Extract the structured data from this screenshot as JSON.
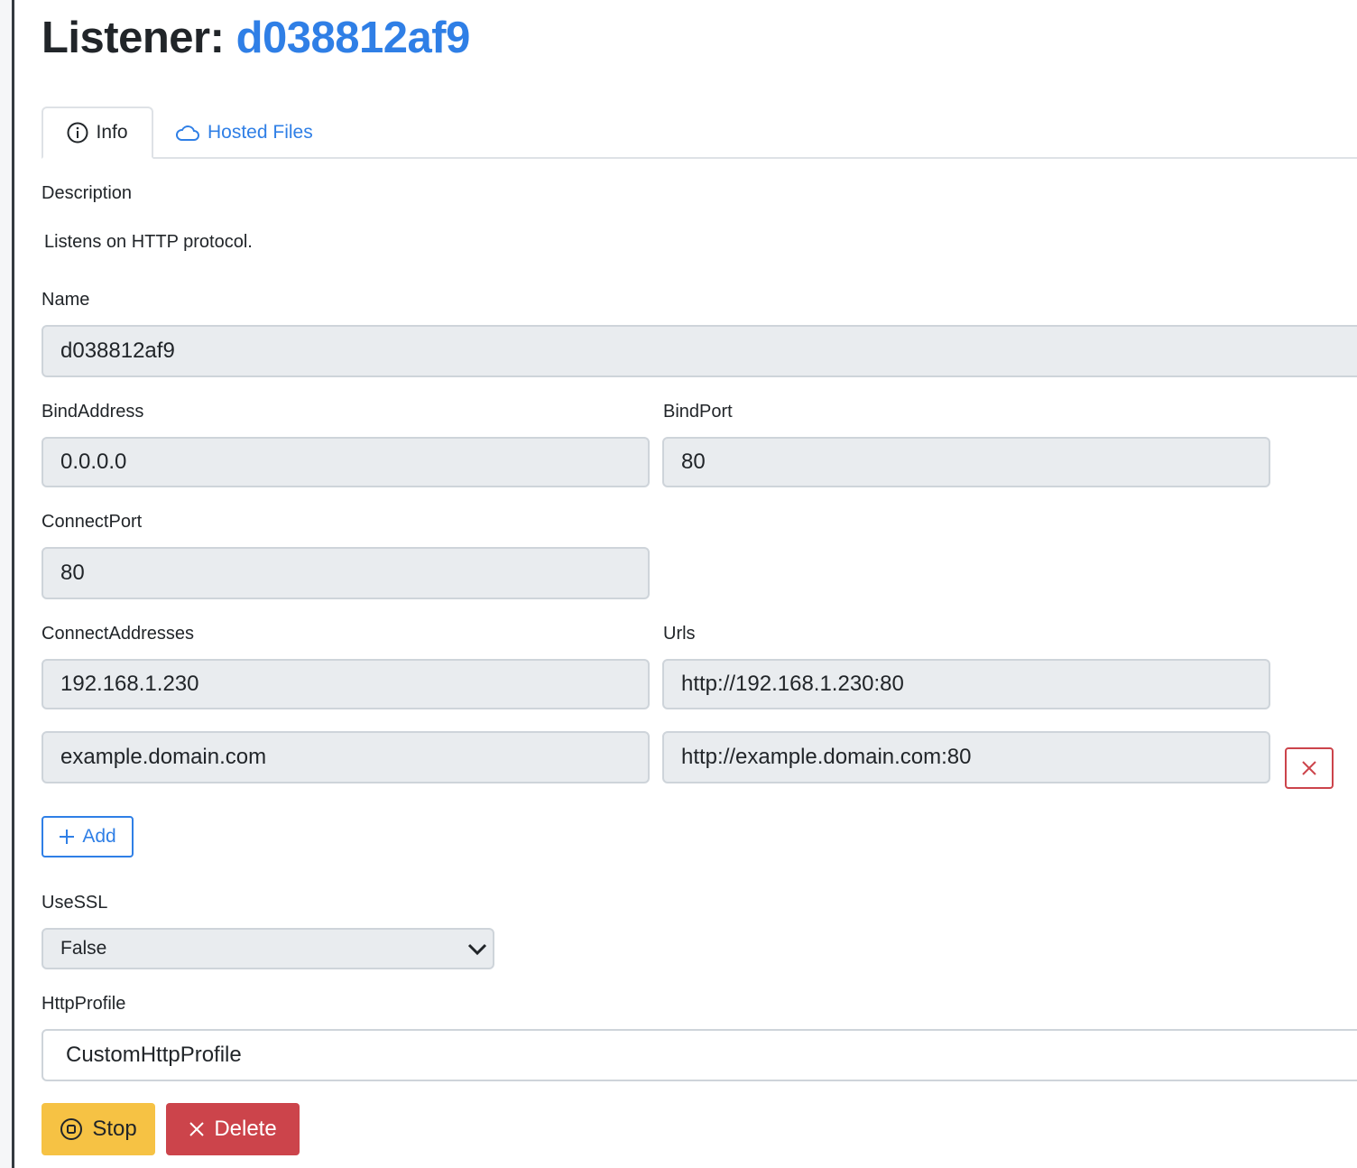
{
  "title": {
    "prefix": "Listener:",
    "name": "d038812af9"
  },
  "tabs": [
    {
      "label": "Info",
      "icon": "info-circle-icon"
    },
    {
      "label": "Hosted Files",
      "icon": "cloud-icon"
    }
  ],
  "description": {
    "label": "Description",
    "value": "Listens on HTTP protocol."
  },
  "fields": {
    "name": {
      "label": "Name",
      "value": "d038812af9"
    },
    "bind_address": {
      "label": "BindAddress",
      "value": "0.0.0.0"
    },
    "bind_port": {
      "label": "BindPort",
      "value": "80"
    },
    "connect_port": {
      "label": "ConnectPort",
      "value": "80"
    },
    "connect_addresses": {
      "label": "ConnectAddresses",
      "values": [
        "192.168.1.230",
        "example.domain.com"
      ]
    },
    "urls": {
      "label": "Urls",
      "values": [
        "http://192.168.1.230:80",
        "http://example.domain.com:80"
      ]
    },
    "use_ssl": {
      "label": "UseSSL",
      "value": "False"
    },
    "http_profile": {
      "label": "HttpProfile",
      "value": "CustomHttpProfile"
    }
  },
  "buttons": {
    "add": "Add",
    "stop": "Stop",
    "delete": "Delete"
  },
  "colors": {
    "primary": "#2f7fe6",
    "warning": "#f6c244",
    "danger": "#cc444b"
  }
}
